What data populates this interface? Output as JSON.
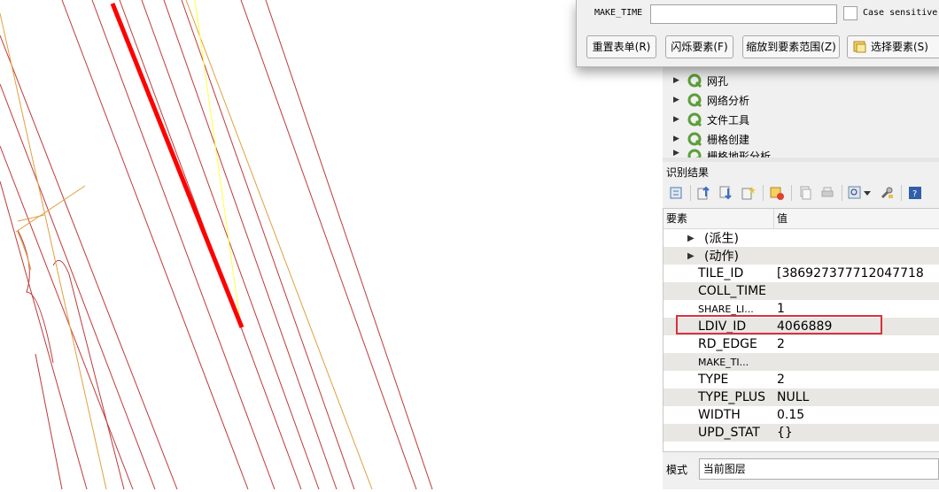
{
  "dialog": {
    "field_label": "MAKE_TIME",
    "field_value": "",
    "case_label": "Case sensitive",
    "buttons": {
      "reset": "重置表单(R)",
      "flash": "闪烁要素(F)",
      "zoom": "缩放到要素范围(Z)",
      "select": "选择要素(S)"
    }
  },
  "processing": {
    "items": [
      {
        "label": "网孔",
        "icon": "qgis-provider-icon"
      },
      {
        "label": "网络分析",
        "icon": "qgis-provider-icon"
      },
      {
        "label": "文件工具",
        "icon": "qgis-provider-icon"
      },
      {
        "label": "栅格创建",
        "icon": "qgis-provider-icon"
      },
      {
        "label": "栅格地形分析",
        "icon": "qgis-provider-icon"
      }
    ]
  },
  "identify": {
    "title": "识别结果",
    "toolbar_icons": [
      "expand-tree-icon",
      "collapse-all-icon",
      "expand-all-icon",
      "expand-new-icon",
      "clear-results-icon",
      "copy-feature-icon",
      "print-icon",
      "identify-options-icon",
      "settings-icon",
      "help-icon"
    ],
    "columns": {
      "feature": "要素",
      "value": "值"
    },
    "groups": [
      "(派生)",
      "(动作)"
    ],
    "rows": [
      {
        "key": "TILE_ID",
        "value": "[386927377712047718"
      },
      {
        "key": "COLL_TIME",
        "value": ""
      },
      {
        "key": "SHARE_LI...",
        "value": "1"
      },
      {
        "key": "LDIV_ID",
        "value": "4066889"
      },
      {
        "key": "RD_EDGE",
        "value": "2"
      },
      {
        "key": "MAKE_TI...",
        "value": ""
      },
      {
        "key": "TYPE",
        "value": "2"
      },
      {
        "key": "TYPE_PLUS",
        "value": "NULL"
      },
      {
        "key": "WIDTH",
        "value": "0.15"
      },
      {
        "key": "UPD_STAT",
        "value": "{}"
      }
    ],
    "highlighted_row": "LDIV_ID",
    "mode_label": "模式",
    "mode_value": "当前图层"
  },
  "colors": {
    "road_line": "#c0393b",
    "lane_line": "#e0a040",
    "selected_line": "#ff0000",
    "yellow_line": "#ffff40",
    "highlight_box": "#d8323c"
  }
}
